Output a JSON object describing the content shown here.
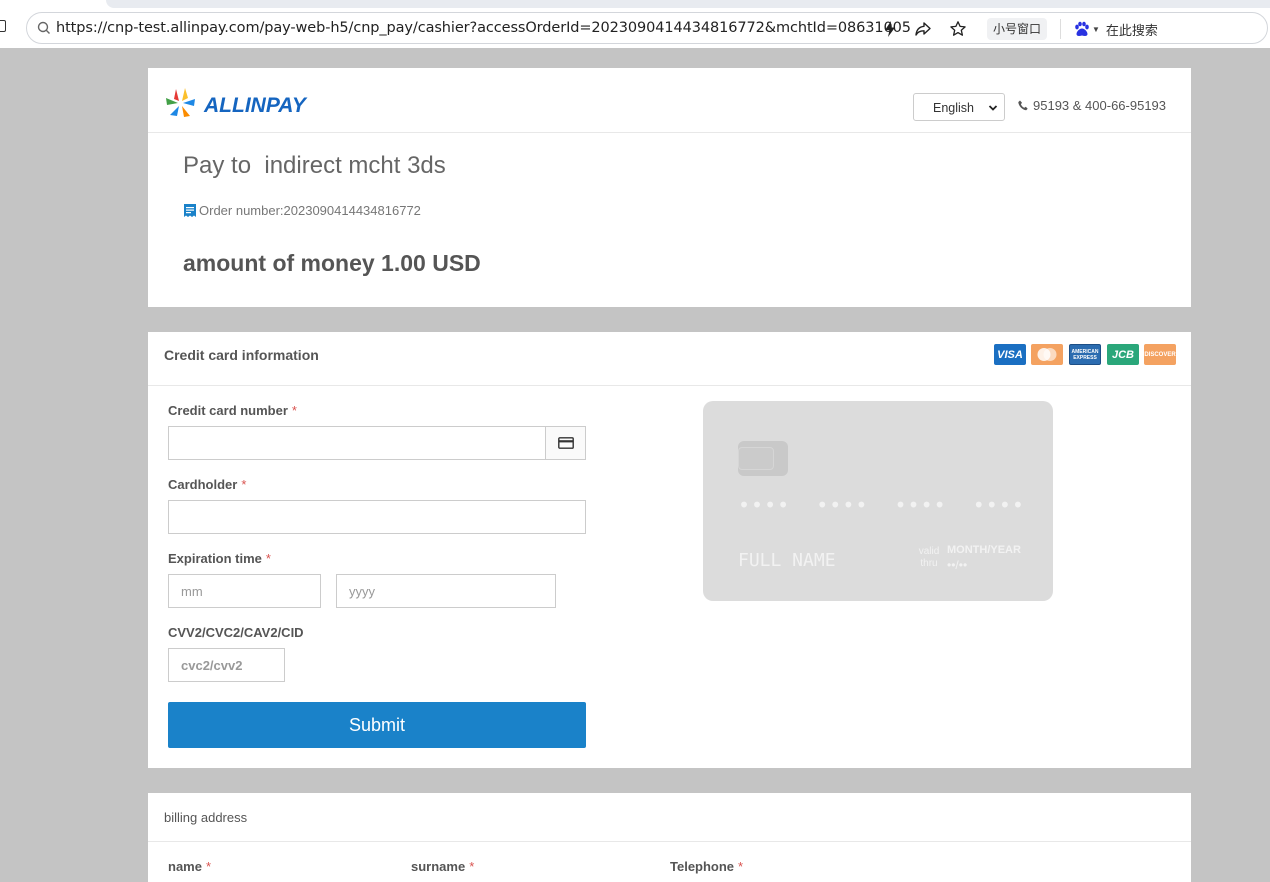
{
  "browser": {
    "url": "https://cnp-test.allinpay.com/pay-web-h5/cnp_pay/cashier?accessOrderId=2023090414434816772&mchtId=08631005",
    "small_window_label": "小号窗口",
    "search_placeholder": "在此搜索"
  },
  "header": {
    "logo_text": "ALLINPAY",
    "language": "English",
    "phone": "95193 & 400-66-95193"
  },
  "order": {
    "pay_to": "Pay to  indirect mcht 3ds",
    "order_number": "Order number:2023090414434816772",
    "amount": "amount of money 1.00 USD"
  },
  "card_form": {
    "title": "Credit card information",
    "brands": [
      "VISA",
      "MasterCard",
      "AMERICAN EXPRESS",
      "JCB",
      "DISCOVER"
    ],
    "card_number_label": "Credit card number",
    "cardholder_label": "Cardholder",
    "expiration_label": "Expiration time",
    "month_placeholder": "mm",
    "year_placeholder": "yyyy",
    "cvv_label": "CVV2/CVC2/CAV2/CID",
    "cvv_placeholder": "cvc2/cvv2",
    "submit_label": "Submit",
    "required_mark": "*"
  },
  "card_preview": {
    "number": "••••  ••••  ••••  ••••",
    "name": "FULL NAME",
    "valid_thru": "valid thru",
    "expiry_label": "MONTH/YEAR",
    "expiry_value": "••/••"
  },
  "billing": {
    "title": "billing address",
    "name_label": "name",
    "surname_label": "surname",
    "telephone_label": "Telephone"
  },
  "colors": {
    "page_bg": "#c4c4c4",
    "accent": "#1a82c9",
    "required": "#d9534f",
    "visa": "#1a6fc2",
    "mastercard": "#f4a261",
    "amex": "#2b6cb0",
    "jcb": "#2aa77a",
    "discover": "#f4a261"
  }
}
